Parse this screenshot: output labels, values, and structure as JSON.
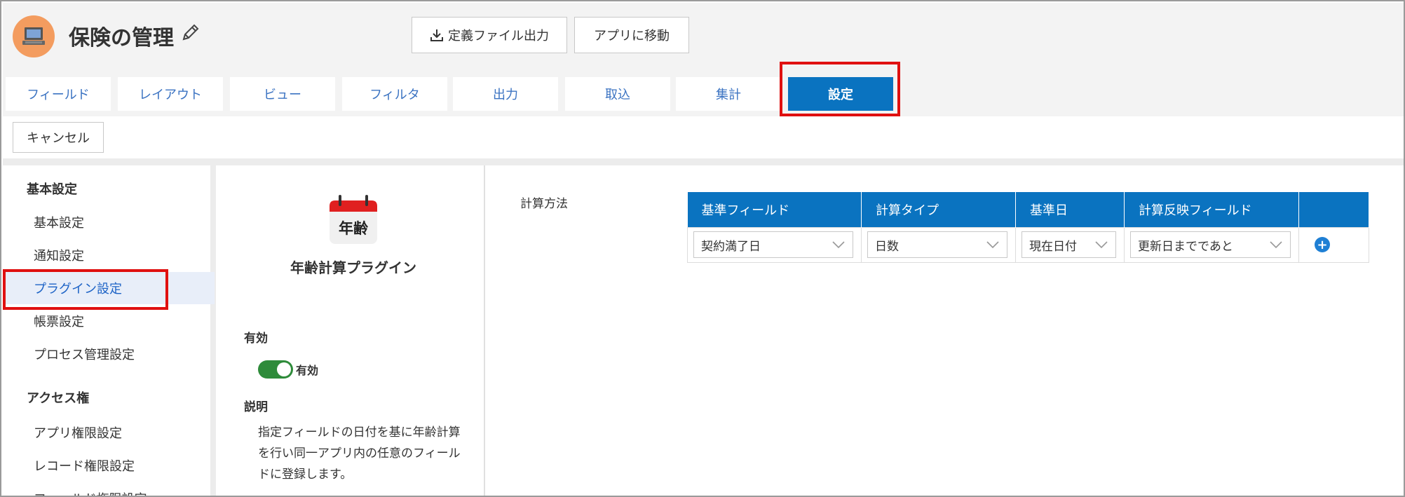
{
  "header": {
    "app_title": "保険の管理",
    "export_label": "定義ファイル出力",
    "goto_app_label": "アプリに移動"
  },
  "tabs": [
    {
      "label": "フィールド"
    },
    {
      "label": "レイアウト"
    },
    {
      "label": "ビュー"
    },
    {
      "label": "フィルタ"
    },
    {
      "label": "出力"
    },
    {
      "label": "取込"
    },
    {
      "label": "集計"
    },
    {
      "label": "設定",
      "active": true
    }
  ],
  "toolbar": {
    "cancel_label": "キャンセル"
  },
  "sidebar": {
    "heading_basic": "基本設定",
    "items_basic": [
      "基本設定",
      "通知設定",
      "プラグイン設定",
      "帳票設定",
      "プロセス管理設定"
    ],
    "heading_access": "アクセス権",
    "items_access": [
      "アプリ権限設定",
      "レコード権限設定",
      "フィールド権限設定"
    ]
  },
  "plugin": {
    "icon_text": "年齢",
    "name": "年齢計算プラグイン",
    "enabled_heading": "有効",
    "enabled_toggle_label": "有効",
    "enabled": true,
    "description_heading": "説明",
    "description": "指定フィールドの日付を基に年齢計算を行い同一アプリ内の任意のフィールドに登録します。"
  },
  "settings": {
    "calc_method_label": "計算方法",
    "table": {
      "headers": [
        "基準フィールド",
        "計算タイプ",
        "基準日",
        "計算反映フィールド",
        ""
      ],
      "row": {
        "base_field": "契約満了日",
        "calc_type": "日数",
        "base_date": "現在日付",
        "target_field": "更新日までであと"
      }
    }
  },
  "colors": {
    "accent": "#0a73c0",
    "highlight": "#e01010",
    "toggle_on": "#2e8b3a",
    "app_icon_bg": "#f39c5f"
  }
}
